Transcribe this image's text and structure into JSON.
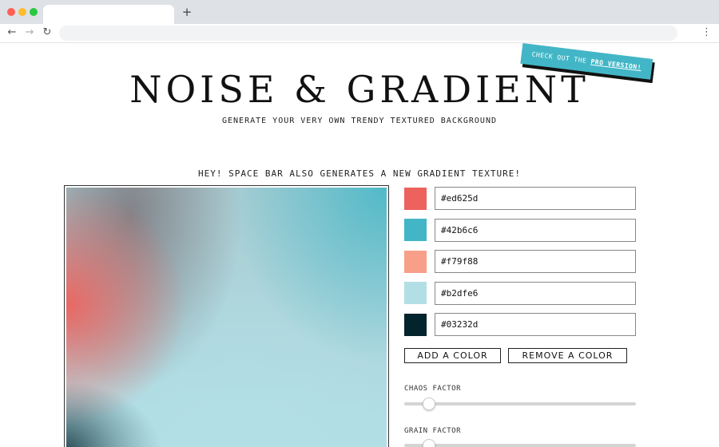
{
  "browser": {
    "new_tab_symbol": "+",
    "back_symbol": "←",
    "forward_symbol": "→",
    "reload_symbol": "↻",
    "menu_symbol": "⋮"
  },
  "page": {
    "title": "NOISE & GRADIENT",
    "subtitle": "GENERATE YOUR VERY OWN TRENDY TEXTURED BACKGROUND",
    "pro_badge": {
      "prefix": "CHECK OUT THE ",
      "link": "PRO VERSION!",
      "color": "#42b6c6"
    },
    "hint": "HEY! SPACE BAR ALSO GENERATES A NEW GRADIENT TEXTURE!"
  },
  "colors": [
    {
      "hex": "#ed625d"
    },
    {
      "hex": "#42b6c6"
    },
    {
      "hex": "#f79f88"
    },
    {
      "hex": "#b2dfe6"
    },
    {
      "hex": "#03232d"
    }
  ],
  "buttons": {
    "add": "ADD A COLOR",
    "remove": "REMOVE A COLOR"
  },
  "sliders": {
    "chaos": {
      "label": "CHAOS FACTOR",
      "value_fraction": 0.1
    },
    "grain": {
      "label": "GRAIN FACTOR",
      "value_fraction": 0.1
    }
  }
}
